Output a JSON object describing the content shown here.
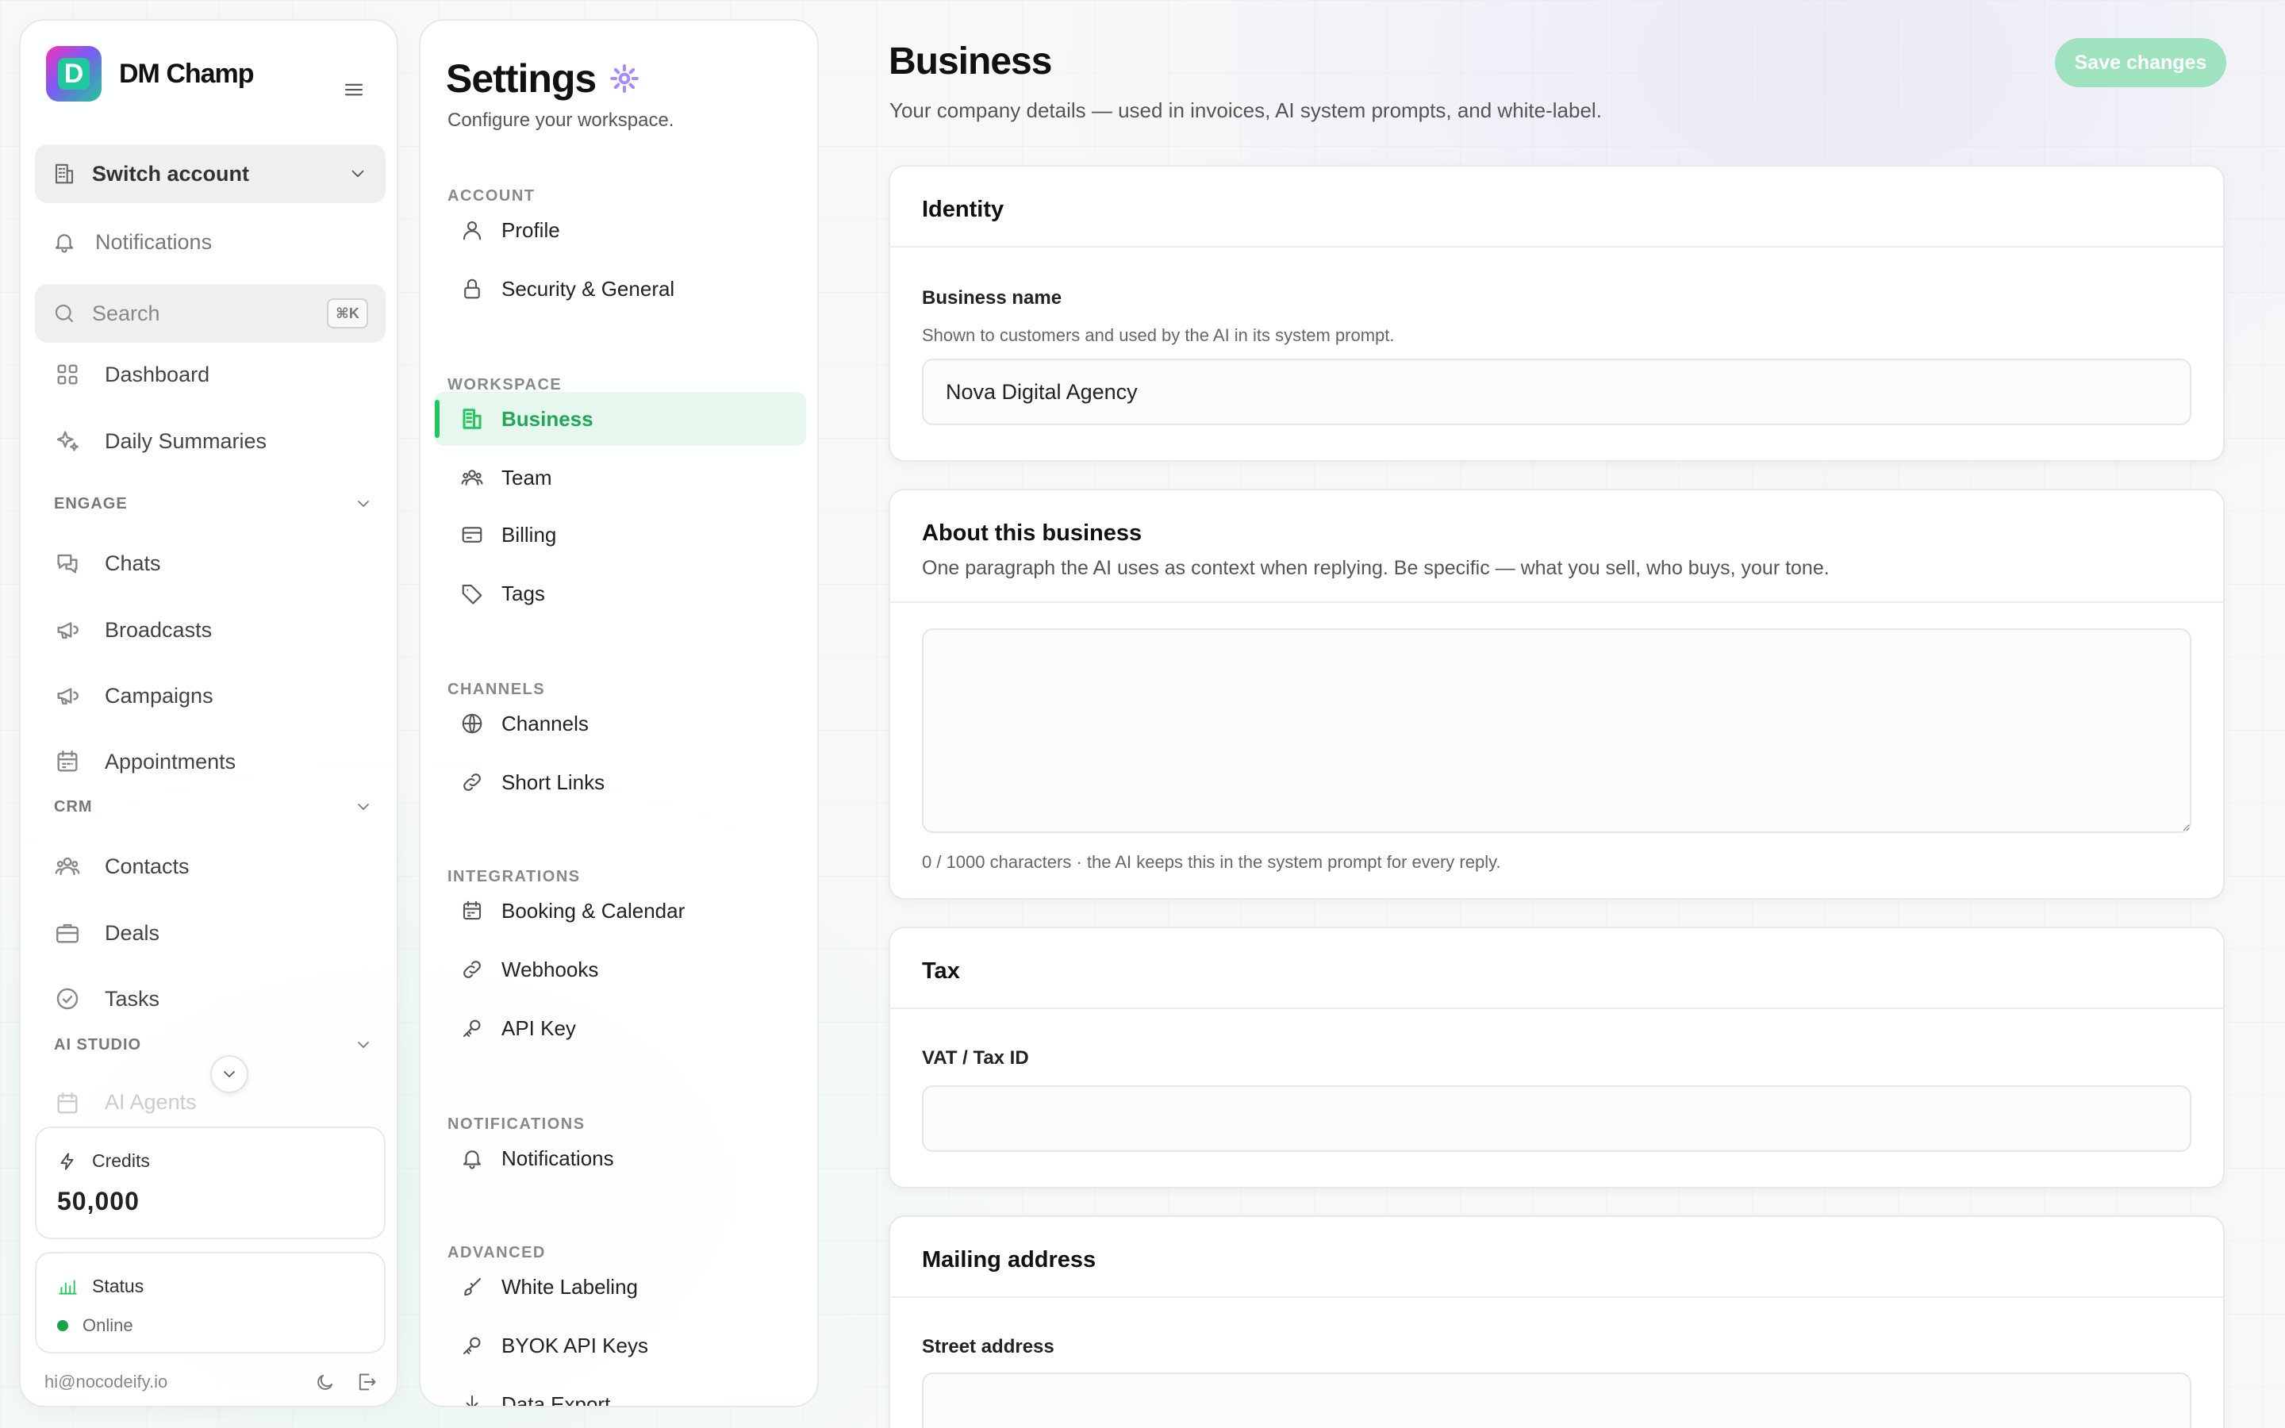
{
  "brand": {
    "name": "DM Champ"
  },
  "sidebar": {
    "switch_account": "Switch account",
    "notifications": "Notifications",
    "search_placeholder": "Search",
    "search_shortcut": "⌘K",
    "dashboard": "Dashboard",
    "daily_summaries": "Daily Summaries",
    "engage": {
      "title": "ENGAGE",
      "items": [
        "Chats",
        "Broadcasts",
        "Campaigns",
        "Appointments"
      ]
    },
    "crm": {
      "title": "CRM",
      "items": [
        "Contacts",
        "Deals",
        "Tasks"
      ]
    },
    "ai_studio": {
      "title": "AI STUDIO",
      "partial_item": "AI Agents"
    },
    "credits": {
      "label": "Credits",
      "value": "50,000"
    },
    "status": {
      "label": "Status",
      "value": "Online"
    },
    "email": "hi@nocodeify.io"
  },
  "settings_nav": {
    "title": "Settings",
    "subtitle": "Configure your workspace.",
    "groups": {
      "account": {
        "title": "ACCOUNT",
        "items": [
          "Profile",
          "Security & General"
        ]
      },
      "workspace": {
        "title": "WORKSPACE",
        "items": [
          "Business",
          "Team",
          "Billing",
          "Tags"
        ]
      },
      "channels": {
        "title": "CHANNELS",
        "items": [
          "Channels",
          "Short Links"
        ]
      },
      "integrations": {
        "title": "INTEGRATIONS",
        "items": [
          "Booking & Calendar",
          "Webhooks",
          "API Key"
        ]
      },
      "notifications": {
        "title": "NOTIFICATIONS",
        "items": [
          "Notifications"
        ]
      },
      "advanced": {
        "title": "ADVANCED",
        "items": [
          "White Labeling",
          "BYOK API Keys",
          "Data Export"
        ]
      }
    },
    "active": "Business"
  },
  "main": {
    "title": "Business",
    "subtitle": "Your company details — used in invoices, AI system prompts, and white-label.",
    "save_label": "Save changes",
    "identity": {
      "title": "Identity",
      "business_name_label": "Business name",
      "business_name_help": "Shown to customers and used by the AI in its system prompt.",
      "business_name_value": "Nova Digital Agency"
    },
    "about": {
      "title": "About this business",
      "description": "One paragraph the AI uses as context when replying. Be specific — what you sell, who buys, your tone.",
      "value": "",
      "counter": "0 / 1000 characters · the AI keeps this in the system prompt for every reply."
    },
    "tax": {
      "title": "Tax",
      "vat_label": "VAT / Tax ID",
      "vat_value": ""
    },
    "mailing": {
      "title": "Mailing address",
      "street_label": "Street address",
      "street_value": ""
    }
  },
  "colors": {
    "accent": "#22c55e",
    "accent_bg": "#e6f8ee",
    "save_button": "#9ee2c0",
    "gear": "#a78bfa"
  }
}
